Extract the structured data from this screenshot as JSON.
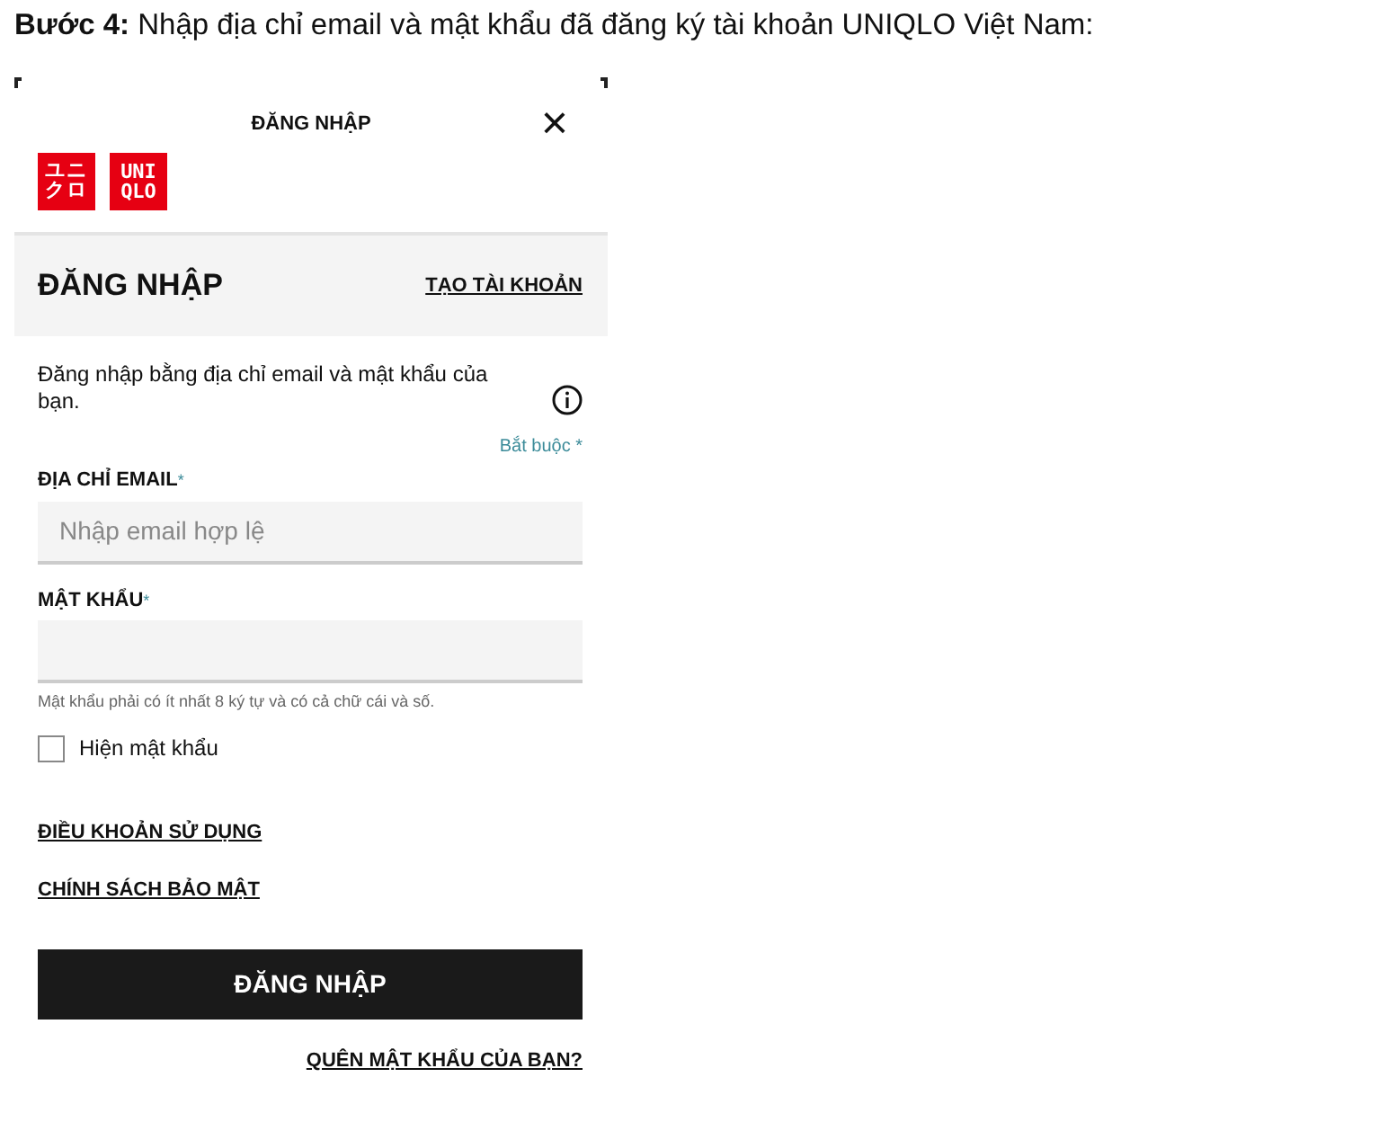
{
  "heading": "**Bước 4:** Nhập địa chỉ email và mật khẩu đã đăng ký tài khoản UNIQLO Việt Nam:",
  "screen": {
    "title": "ĐĂNG NHẬP",
    "close": "×",
    "logo": [
      {
        "kind": "katakana",
        "lines": [
          "ユニ",
          "クロ"
        ]
      },
      {
        "kind": "latin",
        "lines": [
          "UNI",
          "QLO"
        ]
      }
    ],
    "band": {
      "title": "ĐĂNG NHẬP",
      "link": "TẠO TÀI KHOẢN"
    },
    "intro": "Đăng nhập bằng địa chỉ email và mật khẩu của bạn.",
    "required_note": "Bắt buộc *",
    "fields": [
      {
        "label": "ĐỊA CHỈ EMAIL",
        "mark": "*",
        "placeholder": "Nhập email hợp lệ"
      },
      {
        "label": "MẬT KHẨU",
        "mark": "*",
        "hint": "Mật khẩu phải có ít nhất 8 ký tự và có cả chữ cái và số."
      }
    ],
    "show_password": {
      "label": "Hiện mật khẩu",
      "checked": false
    },
    "links": [
      "ĐIỀU KHOẢN SỬ DỤNG",
      "CHÍNH SÁCH BẢO MẬT"
    ],
    "submit": "ĐĂNG NHẬP",
    "forgot": "QUÊN MẬT KHẨU CỦA BẠN?"
  }
}
